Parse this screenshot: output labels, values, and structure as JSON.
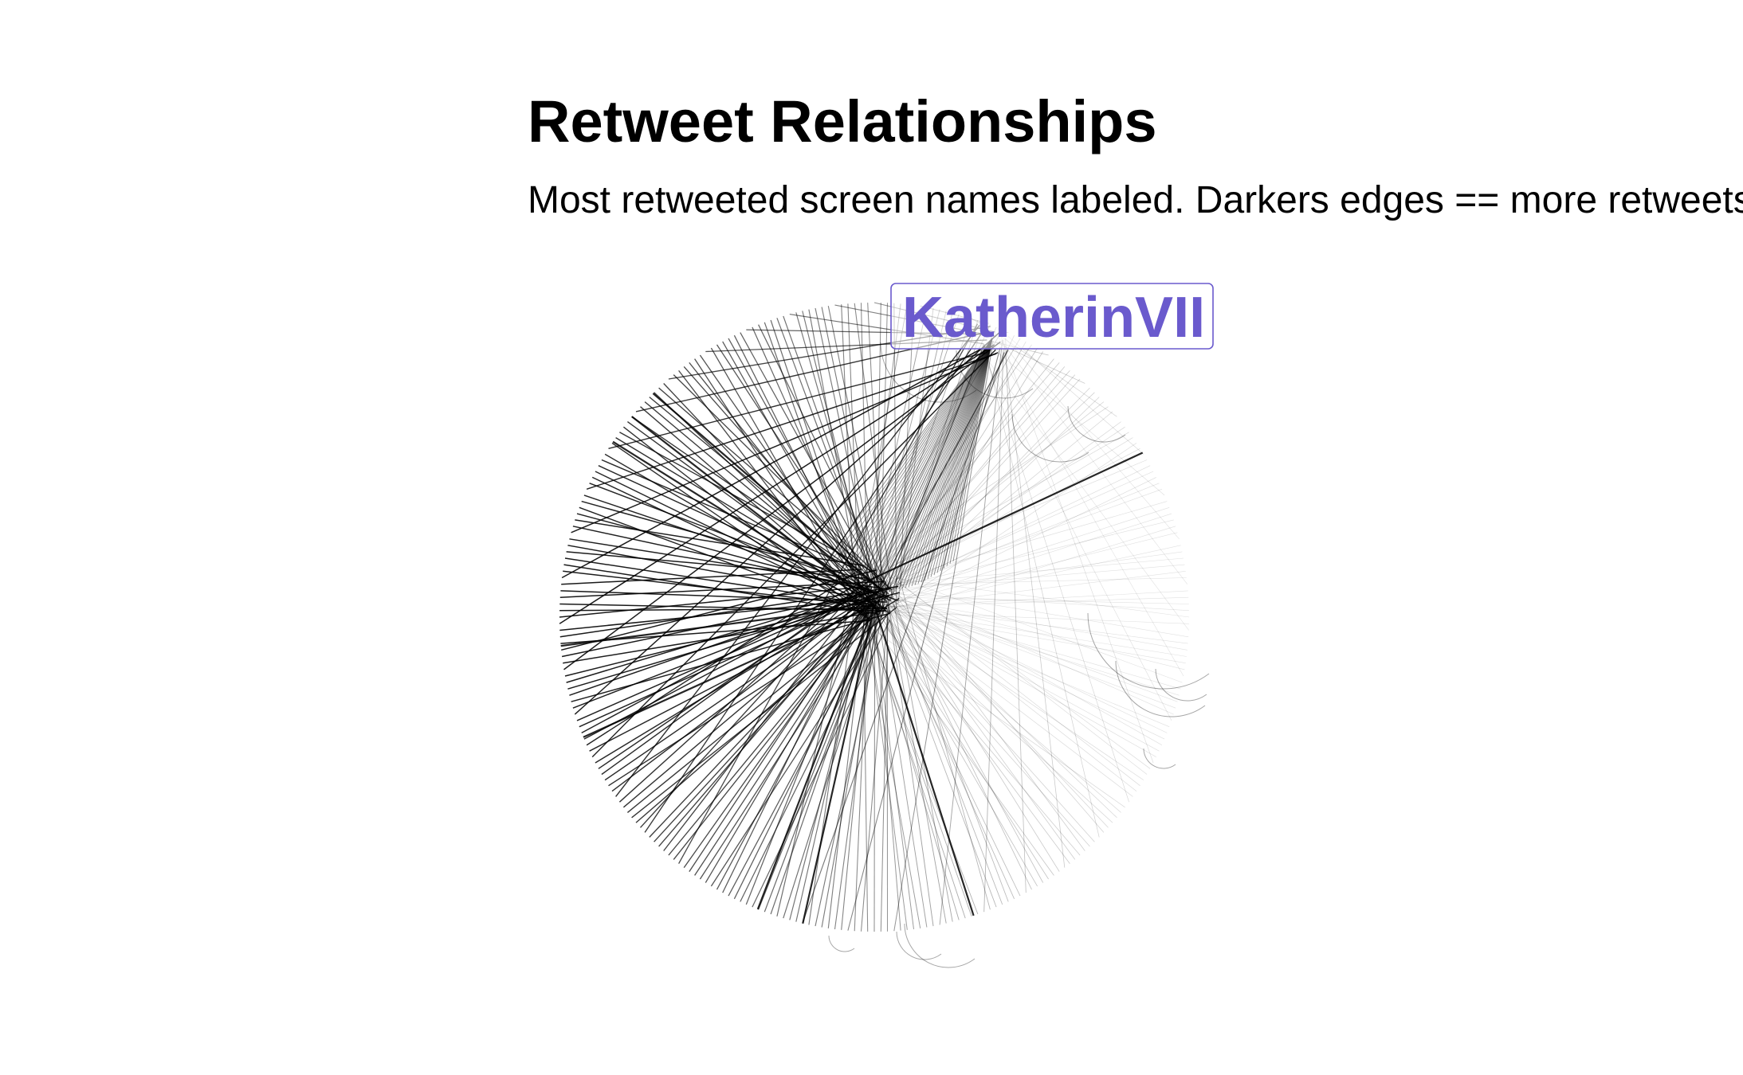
{
  "header": {
    "title": "Retweet Relationships",
    "subtitle": "Most retweeted screen names labeled. Darkers edges == more retweets"
  },
  "graph": {
    "layout": "circle",
    "node_count": 300,
    "edge_color": "#000000",
    "label_color": "#6a5acd",
    "labeled_node": "KatherinVII"
  }
}
